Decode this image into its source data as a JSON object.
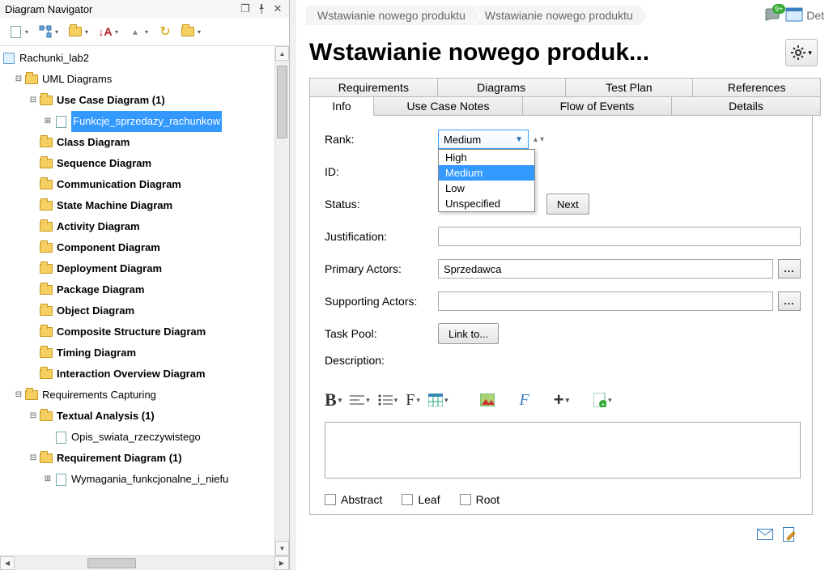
{
  "navigator": {
    "title": "Diagram Navigator",
    "root": "Rachunki_lab2",
    "uml_group": "UML Diagrams",
    "use_case_group": "Use Case Diagram (1)",
    "use_case_item": "Funkcje_sprzedazy_rachunkow",
    "diagrams": [
      "Class Diagram",
      "Sequence Diagram",
      "Communication Diagram",
      "State Machine Diagram",
      "Activity Diagram",
      "Component Diagram",
      "Deployment Diagram",
      "Package Diagram",
      "Object Diagram",
      "Composite Structure Diagram",
      "Timing Diagram",
      "Interaction Overview Diagram"
    ],
    "req_group": "Requirements Capturing",
    "textual_group": "Textual Analysis (1)",
    "textual_item": "Opis_swiata_rzeczywistego",
    "req_diagram_group": "Requirement Diagram (1)",
    "req_diagram_item": "Wymagania_funkcjonalne_i_niefu"
  },
  "breadcrumb": {
    "a": "Wstawianie nowego produktu",
    "b": "Wstawianie nowego produktu",
    "c": "Det",
    "badge_count": "9+"
  },
  "heading": "Wstawianie nowego produk...",
  "tabs_back": {
    "a": "Requirements",
    "b": "Diagrams",
    "c": "Test Plan",
    "d": "References"
  },
  "tabs_front": {
    "a": "Info",
    "b": "Use Case Notes",
    "c": "Flow of Events",
    "d": "Details"
  },
  "form": {
    "rank_label": "Rank:",
    "rank_value": "Medium",
    "rank_options": {
      "a": "High",
      "b": "Medium",
      "c": "Low",
      "d": "Unspecified"
    },
    "id_label": "ID:",
    "status_label": "Status:",
    "status_btn": "Next",
    "justification_label": "Justification:",
    "primary_label": "Primary Actors:",
    "primary_value": "Sprzedawca",
    "supporting_label": "Supporting Actors:",
    "supporting_value": "",
    "taskpool_label": "Task Pool:",
    "taskpool_btn": "Link to...",
    "description_label": "Description:",
    "abstract": "Abstract",
    "leaf": "Leaf",
    "root": "Root",
    "dots": "..."
  }
}
